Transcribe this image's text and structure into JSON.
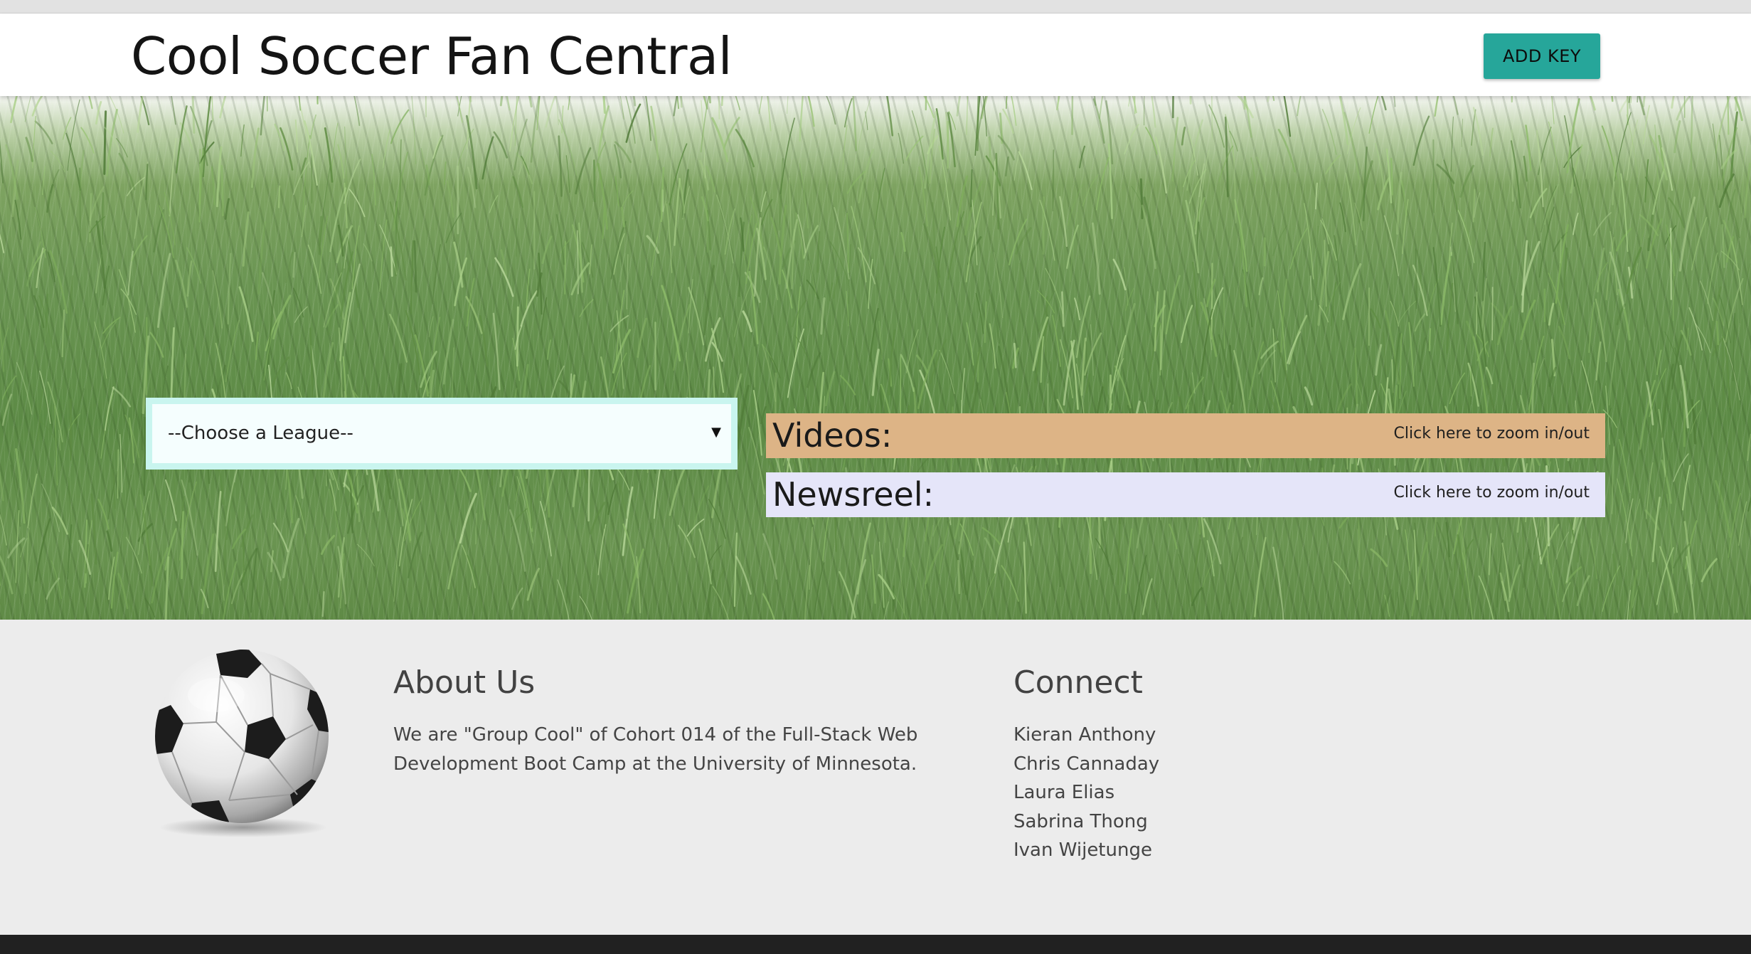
{
  "header": {
    "brand": "Cool Soccer Fan Central",
    "add_key_label": "ADD KEY"
  },
  "main": {
    "league_select": {
      "selected": "--Choose a League--",
      "arrow": "▼"
    },
    "panels": {
      "videos": {
        "title": "Videos:",
        "zoom_label": "Click here to zoom in/out",
        "color": "#ddb486"
      },
      "newsreel": {
        "title": "Newsreel:",
        "zoom_label": "Click here to zoom in/out",
        "color": "#e5e5f9"
      }
    }
  },
  "footer": {
    "about": {
      "title": "About Us",
      "lines": [
        "We are \"Group Cool\" of Cohort 014 of the Full-Stack Web",
        "Development Boot Camp at the University of Minnesota."
      ]
    },
    "connect": {
      "title": "Connect",
      "names": [
        "Kieran Anthony",
        "Chris Cannaday",
        "Laura Elias",
        "Sabrina Thong",
        "Ivan Wijetunge"
      ]
    }
  },
  "colors": {
    "accent": "#26a69a",
    "footer_bg": "#ececec",
    "bottom_bar": "#212121"
  },
  "icons": {
    "dropdown": "chevron-down-icon",
    "logo": "soccer-ball-icon"
  }
}
